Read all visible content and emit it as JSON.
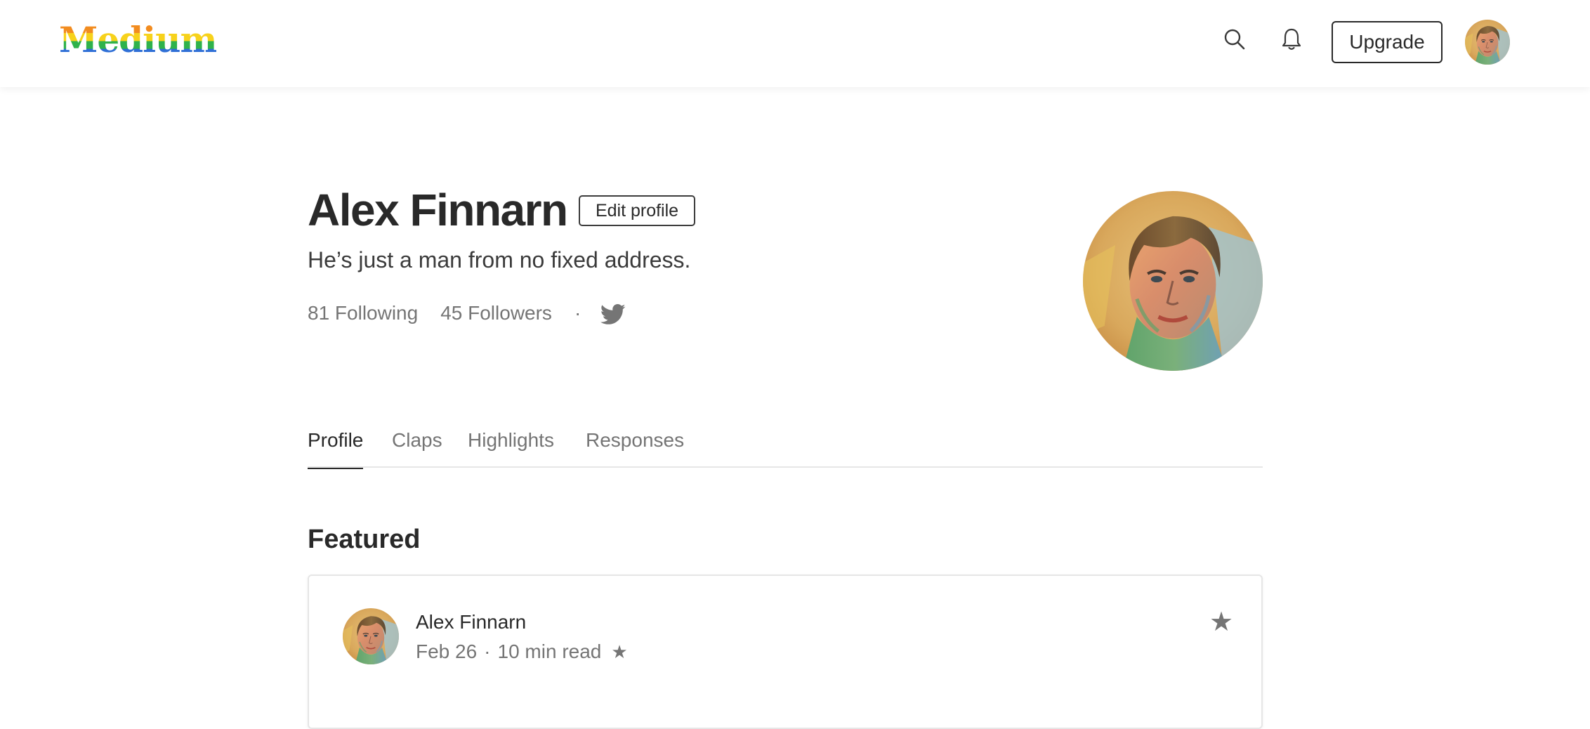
{
  "nav": {
    "logo": "Medium",
    "upgrade_label": "Upgrade"
  },
  "profile": {
    "name": "Alex Finnarn",
    "edit_label": "Edit profile",
    "bio": "He’s just a man from no fixed address.",
    "following": "81 Following",
    "followers": "45 Followers",
    "separator": "·"
  },
  "tabs": [
    {
      "label": "Profile",
      "active": true
    },
    {
      "label": "Claps",
      "active": false
    },
    {
      "label": "Highlights",
      "active": false
    },
    {
      "label": "Responses",
      "active": false
    }
  ],
  "featured": {
    "heading": "Featured",
    "card": {
      "author": "Alex Finnarn",
      "date": "Feb 26",
      "separator": "·",
      "read_time": "10 min read",
      "member_star": "★",
      "bookmark_star": "★"
    }
  },
  "icons": {
    "search": "search-icon",
    "notifications": "bell-icon",
    "social": "twitter-icon",
    "bookmark": "star-icon"
  },
  "colors": {
    "text_primary": "#292929",
    "text_secondary": "#757575",
    "divider": "#e6e6e6",
    "twitter": "#757575"
  }
}
